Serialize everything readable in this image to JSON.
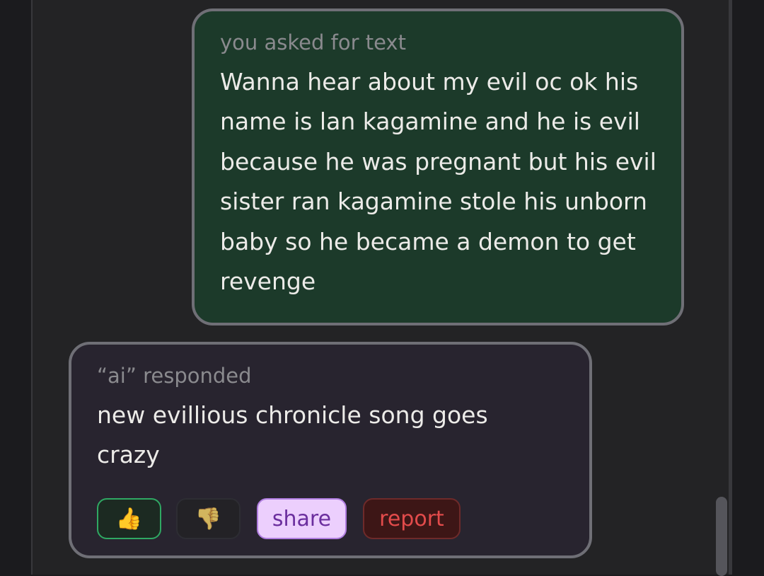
{
  "user_message": {
    "meta": "you asked for text",
    "text": "Wanna hear about my evil oc ok his name is lan kagamine and he is evil because he was pregnant but his evil sister ran kagamine stole his unborn baby so he became a demon to get revenge"
  },
  "ai_message": {
    "meta": "“ai” responded",
    "text": "new evillious chronicle song goes crazy"
  },
  "actions": {
    "thumbs_up": "👍",
    "thumbs_down": "👎",
    "share_label": "share",
    "report_label": "report"
  },
  "colors": {
    "user_bubble": "#1c3a2a",
    "ai_bubble": "#28242f",
    "thumbs_up_border": "#2fa863",
    "share_bg": "#eccffd",
    "report_text": "#e24b4b"
  }
}
